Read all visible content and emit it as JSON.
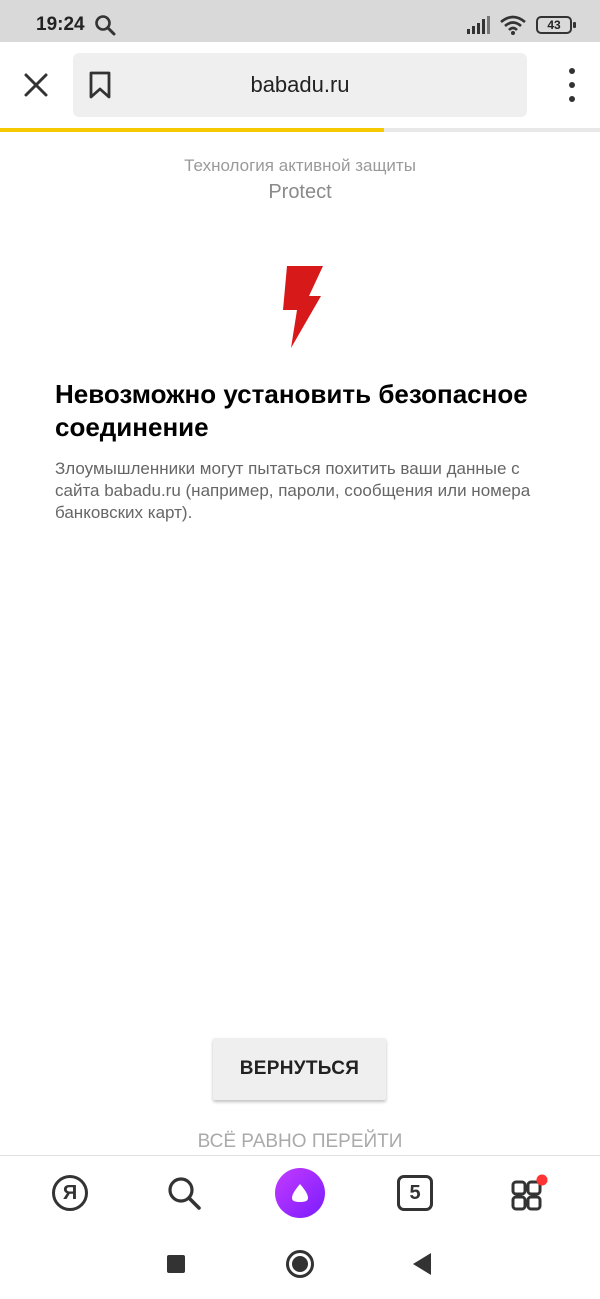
{
  "status_bar": {
    "time": "19:24",
    "battery": "43",
    "icons": [
      "search-icon",
      "signal-icon",
      "wifi-icon",
      "battery-icon"
    ]
  },
  "toolbar": {
    "url": "babadu.ru",
    "icons": [
      "close-icon",
      "bookmark-icon",
      "more-vertical-icon"
    ],
    "load_progress_percent": 64
  },
  "page": {
    "tech_label": "Технология активной защиты",
    "tech_name": "Protect",
    "warning_icon": "lightning-bolt-icon",
    "title": "Невозможно установить безопасное соединение",
    "description": "Злоумышленники могут пытаться похитить ваши данные с сайта babadu.ru (например, пароли, сообщения или номера банковских карт).",
    "back_button": "ВЕРНУТЬСЯ",
    "proceed_link": "ВСЁ РАВНО ПЕРЕЙТИ"
  },
  "bottom_bar": {
    "yandex_label": "Я",
    "tabs_count": "5",
    "icons": [
      "yandex-icon",
      "search-icon",
      "alice-icon",
      "tabs-icon",
      "services-grid-icon"
    ]
  },
  "colors": {
    "accent_progress": "#f6c800",
    "warning_red": "#d81919",
    "alice_purple": "#9b2cff",
    "notification_dot": "#ff3333"
  }
}
